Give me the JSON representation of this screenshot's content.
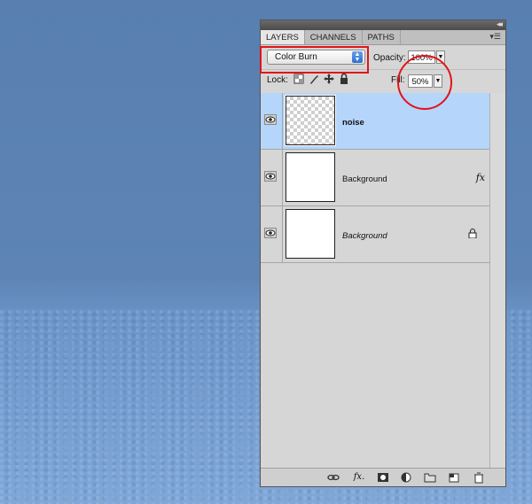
{
  "panel": {
    "tabs": [
      "LAYERS",
      "CHANNELS",
      "PATHS"
    ],
    "blend_mode": "Color Burn",
    "opacity_label": "Opacity:",
    "opacity_value": "100%",
    "lock_label": "Lock:",
    "fill_label": "Fill:",
    "fill_value": "50%"
  },
  "layers": [
    {
      "name": "noise",
      "selected": true,
      "thumbnail": "transparent-checker"
    },
    {
      "name": "Background",
      "selected": false,
      "thumbnail": "white",
      "has_fx": true
    },
    {
      "name": "Background",
      "selected": false,
      "thumbnail": "white",
      "locked": true
    }
  ],
  "icons": {
    "eye": "eye-icon",
    "fx": "fx",
    "lock": "lock-icon"
  },
  "colors": {
    "highlight_red": "#e0141a",
    "selected_layer": "#b5d5fb",
    "panel_bg": "#d6d6d6"
  }
}
